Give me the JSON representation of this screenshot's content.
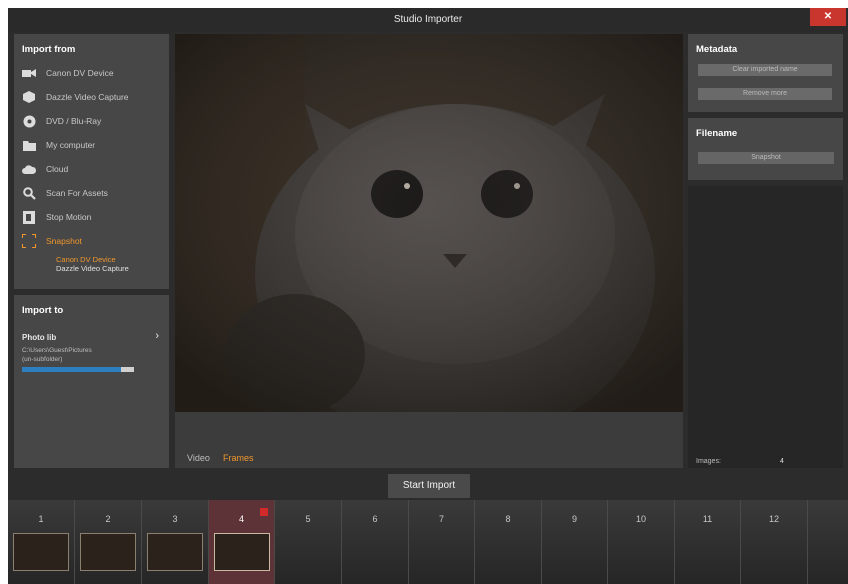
{
  "window": {
    "title": "Studio Importer",
    "close_label": "✕"
  },
  "import_from": {
    "heading": "Import from",
    "items": [
      {
        "label": "Canon DV Device",
        "icon": "camcorder-icon"
      },
      {
        "label": "Dazzle Video Capture",
        "icon": "capture-card-icon"
      },
      {
        "label": "DVD / Blu-Ray",
        "icon": "disc-icon"
      },
      {
        "label": "My computer",
        "icon": "folder-icon"
      },
      {
        "label": "Cloud",
        "icon": "cloud-icon"
      },
      {
        "label": "Scan For Assets",
        "icon": "search-icon"
      },
      {
        "label": "Stop Motion",
        "icon": "stop-motion-icon"
      },
      {
        "label": "Snapshot",
        "icon": "snapshot-icon",
        "active": true
      }
    ],
    "sub_items": [
      "Canon DV Device",
      "Dazzle Video Capture"
    ]
  },
  "import_to": {
    "heading": "Import to",
    "target_label": "Photo lib",
    "path": "C:\\Users\\Guest\\Pictures",
    "subfolder": "(un-subfolder)",
    "storage_fill_pct": 88
  },
  "metadata": {
    "heading": "Metadata",
    "buttons": [
      "Clear imported name",
      "Remove more"
    ]
  },
  "filename": {
    "heading": "Filename",
    "value": "Snapshot"
  },
  "images": {
    "label": "Images:",
    "count": "4"
  },
  "video_tabs": {
    "video": "Video",
    "frames": "Frames"
  },
  "start_import": "Start Import",
  "frames": [
    {
      "num": "1",
      "has_thumb": true
    },
    {
      "num": "2",
      "has_thumb": true
    },
    {
      "num": "3",
      "has_thumb": true
    },
    {
      "num": "4",
      "has_thumb": true,
      "selected": true
    },
    {
      "num": "5"
    },
    {
      "num": "6"
    },
    {
      "num": "7"
    },
    {
      "num": "8"
    },
    {
      "num": "9"
    },
    {
      "num": "10"
    },
    {
      "num": "11"
    },
    {
      "num": "12"
    }
  ],
  "colors": {
    "accent": "#f0962c",
    "close": "#c9362e",
    "selected_frame": "#5e3337",
    "progress": "#2e7fc0"
  }
}
